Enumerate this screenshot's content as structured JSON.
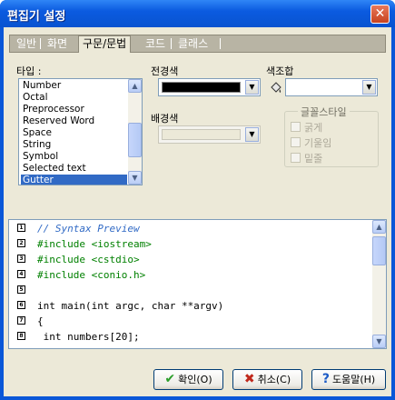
{
  "window": {
    "title": "편집기 설정",
    "close_glyph": "✕"
  },
  "tabs": [
    {
      "label": "일반"
    },
    {
      "label": "화면"
    },
    {
      "label": "구문/문법",
      "active": true
    },
    {
      "label": "코드"
    },
    {
      "label": "클래스"
    }
  ],
  "labels": {
    "element": "타입 :",
    "foreground": "전경색",
    "background": "배경색",
    "scheme": "색조합",
    "font_style": "글꼴스타일"
  },
  "element_list": {
    "items": [
      "Number",
      "Octal",
      "Preprocessor",
      "Reserved Word",
      "Space",
      "String",
      "Symbol",
      "Selected text",
      "Gutter"
    ],
    "selected": "Gutter"
  },
  "foreground_color": "#000000",
  "background_color": "#ece9d8",
  "font_style": {
    "bold": "굵게",
    "italic": "기울임",
    "underline": "밑줄"
  },
  "code_preview": [
    {
      "text": "// Syntax Preview",
      "color": "#316ac5",
      "italic": true,
      "marker": "1"
    },
    {
      "text": "#include <iostream>",
      "color": "#008000",
      "marker": "2"
    },
    {
      "text": "#include <cstdio>",
      "color": "#008000",
      "marker": "3"
    },
    {
      "text": "#include <conio.h>",
      "color": "#008000",
      "marker": "4"
    },
    {
      "text": "",
      "marker": "5"
    },
    {
      "text": "int main(int argc, char **argv)",
      "color": "#000000",
      "marker": "6"
    },
    {
      "text": "{",
      "marker": "7"
    },
    {
      "text": " int numbers[20];",
      "marker": "8"
    }
  ],
  "buttons": {
    "ok": "확인(O)",
    "cancel": "취소(C)",
    "help": "도움말(H)"
  },
  "icons": {
    "ok": "check-icon",
    "cancel": "x-icon",
    "help": "question-icon",
    "scheme": "paint-bucket-icon"
  }
}
